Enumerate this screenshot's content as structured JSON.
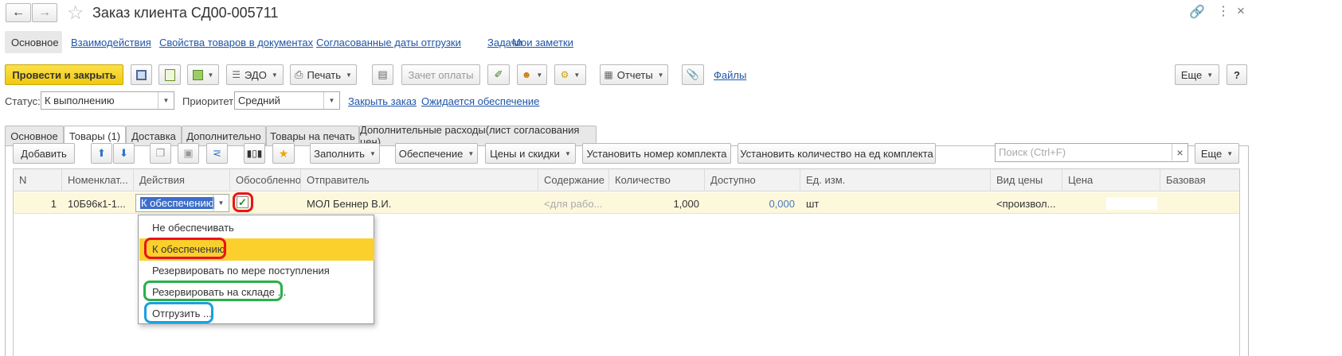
{
  "window": {
    "title": "Заказ клиента СД00-005711",
    "nav_links": [
      "Основное",
      "Взаимодействия",
      "Свойства товаров в документах",
      "Согласованные даты отгрузки",
      "Задачи",
      "Мои заметки"
    ]
  },
  "toolbar": {
    "post_close": "Провести и закрыть",
    "edo": "ЭДО",
    "print": "Печать",
    "payment_offset": "Зачет оплаты",
    "reports": "Отчеты",
    "files": "Файлы",
    "more": "Еще",
    "help": "?"
  },
  "status_bar": {
    "status_label": "Статус:",
    "status_value": "К выполнению",
    "priority_label": "Приоритет:",
    "priority_value": "Средний",
    "close_order": "Закрыть заказ",
    "awaiting": "Ожидается обеспечение"
  },
  "tabs": [
    "Основное",
    "Товары (1)",
    "Доставка",
    "Дополнительно",
    "Товары на печать",
    "Дополнительные расходы(лист согласования цен)"
  ],
  "table_toolbar": {
    "add": "Добавить",
    "fill": "Заполнить",
    "supply": "Обеспечение",
    "prices": "Цены и скидки",
    "set_kit_number": "Установить номер комплекта",
    "set_kit_qty": "Установить количество на ед комплекта",
    "search_placeholder": "Поиск (Ctrl+F)",
    "clear": "×",
    "more": "Еще"
  },
  "table": {
    "columns": [
      "N",
      "Номенклат...",
      "Действия",
      "Обособленно",
      "Отправитель",
      "Содержание",
      "Количество",
      "Доступно",
      "Ед. изм.",
      "Вид цены",
      "Цена",
      "Базовая"
    ],
    "row": {
      "n": "1",
      "item": "10Б96к1-1...",
      "action": "К обеспечению",
      "separate": "✓",
      "sender": "МОЛ Беннер В.И.",
      "content": "<для рабо...",
      "quantity": "1,000",
      "available": "0,000",
      "unit": "шт",
      "price_type": "<произвол..."
    }
  },
  "dropdown": {
    "items": [
      "Не обеспечивать",
      "К обеспечению",
      "Резервировать по мере поступления",
      "Резервировать на складе ...",
      "Отгрузить ..."
    ],
    "selected_index": 1
  },
  "colors": {
    "accent_yellow": "#f5d31b",
    "selection_yellow": "#fbd02c",
    "row_highlight": "#fdf8dc",
    "link_blue": "#1f55a8",
    "mark_red": "#e8141c",
    "mark_green": "#2ab04a",
    "mark_blue": "#1aa0e0"
  }
}
